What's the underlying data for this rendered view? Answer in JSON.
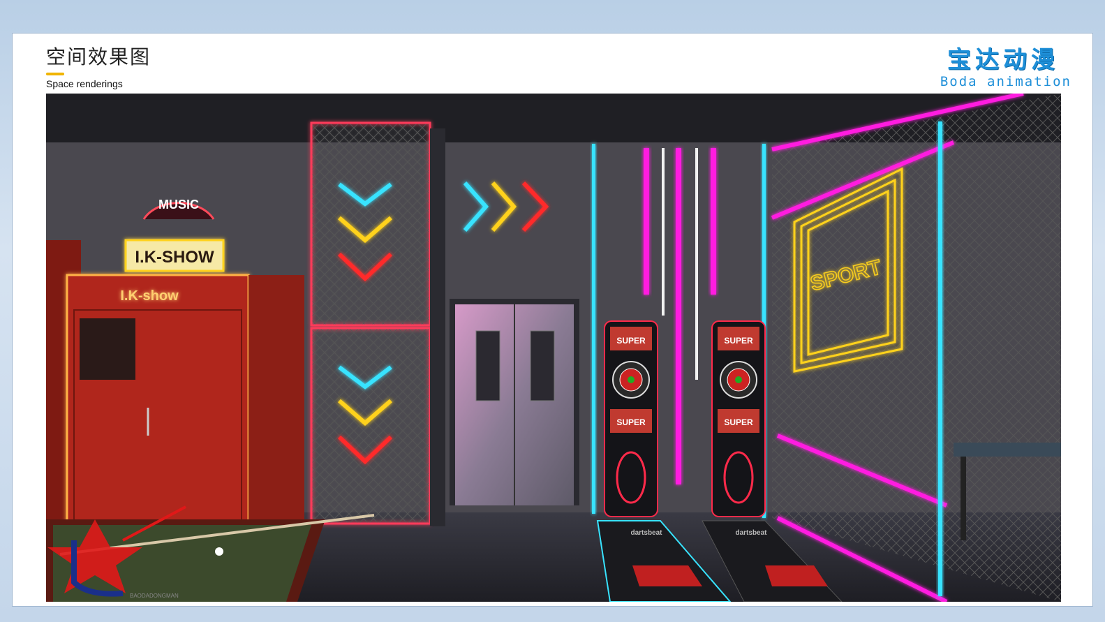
{
  "header": {
    "title_cn": "空间效果图",
    "title_en": "Space renderings"
  },
  "brand": {
    "name_cn": "宝达动漫",
    "name_en": "Boda animation",
    "color": "#1e8fd8"
  },
  "scene": {
    "sign_music": "MUSIC",
    "sign_ikshow_top": "I.K-SHOW",
    "sign_ikshow_booth": "I.K-show",
    "sign_sport": "SPORT",
    "machine_label_top": "SUPER",
    "machine_label_mid": "SUPER",
    "mat_brand": "dartsbeat",
    "watermark": "BAODADONGMAN",
    "colors": {
      "cyan": "#38e3ff",
      "yellow": "#ffd21a",
      "red": "#ff2a2a",
      "magenta": "#ff1fe0",
      "booth_red": "#b0261a"
    }
  }
}
